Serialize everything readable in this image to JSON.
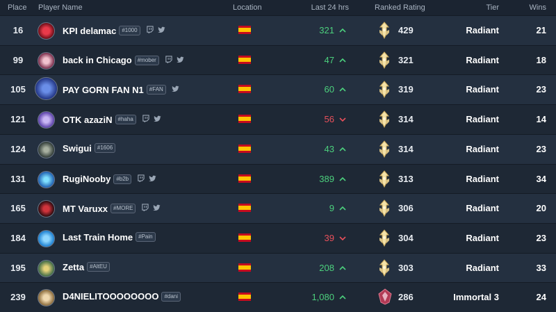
{
  "headers": {
    "place": "Place",
    "player": "Player Name",
    "location": "Location",
    "last24": "Last 24 hrs",
    "rating": "Ranked Rating",
    "tier": "Tier",
    "wins": "Wins"
  },
  "colors": {
    "up": "#4cd07d",
    "down": "#e8505b"
  },
  "rows": [
    {
      "place": "16",
      "name": "KPI delamac",
      "tag": "#1000",
      "social": [
        "twitch-icon",
        "twitter-icon"
      ],
      "location_flag": "spain-flag-icon",
      "last24": "321",
      "trend": "up",
      "rating": "429",
      "tier": "Radiant",
      "wins": "21",
      "rank_icon": "radiant-rank-icon"
    },
    {
      "place": "99",
      "name": "back in Chicago",
      "tag": "#mober",
      "social": [
        "twitch-icon",
        "twitter-icon"
      ],
      "location_flag": "spain-flag-icon",
      "last24": "47",
      "trend": "up",
      "rating": "321",
      "tier": "Radiant",
      "wins": "18",
      "rank_icon": "radiant-rank-icon"
    },
    {
      "place": "105",
      "name": "PAY GORN FAN N1",
      "tag": "#FAN",
      "social": [
        "twitter-icon"
      ],
      "location_flag": "spain-flag-icon",
      "last24": "60",
      "trend": "up",
      "rating": "319",
      "tier": "Radiant",
      "wins": "23",
      "rank_icon": "radiant-rank-icon"
    },
    {
      "place": "121",
      "name": "OTK azaziN",
      "tag": "#haha",
      "social": [
        "twitch-icon",
        "twitter-icon"
      ],
      "location_flag": "spain-flag-icon",
      "last24": "56",
      "trend": "down",
      "rating": "314",
      "tier": "Radiant",
      "wins": "14",
      "rank_icon": "radiant-rank-icon"
    },
    {
      "place": "124",
      "name": "Swigui",
      "tag": "#1606",
      "social": [],
      "location_flag": "spain-flag-icon",
      "last24": "43",
      "trend": "up",
      "rating": "314",
      "tier": "Radiant",
      "wins": "23",
      "rank_icon": "radiant-rank-icon"
    },
    {
      "place": "131",
      "name": "RugiNooby",
      "tag": "#b2b",
      "social": [
        "twitch-icon",
        "twitter-icon"
      ],
      "location_flag": "spain-flag-icon",
      "last24": "389",
      "trend": "up",
      "rating": "313",
      "tier": "Radiant",
      "wins": "34",
      "rank_icon": "radiant-rank-icon"
    },
    {
      "place": "165",
      "name": "MT Varuxx",
      "tag": "#MORE",
      "social": [
        "twitch-icon",
        "twitter-icon"
      ],
      "location_flag": "spain-flag-icon",
      "last24": "9",
      "trend": "up",
      "rating": "306",
      "tier": "Radiant",
      "wins": "20",
      "rank_icon": "radiant-rank-icon"
    },
    {
      "place": "184",
      "name": "Last Train Home",
      "tag": "#Pain",
      "social": [],
      "location_flag": "spain-flag-icon",
      "last24": "39",
      "trend": "down",
      "rating": "304",
      "tier": "Radiant",
      "wins": "23",
      "rank_icon": "radiant-rank-icon"
    },
    {
      "place": "195",
      "name": "Zetta",
      "tag": "#AltEU",
      "social": [],
      "location_flag": "spain-flag-icon",
      "last24": "208",
      "trend": "up",
      "rating": "303",
      "tier": "Radiant",
      "wins": "33",
      "rank_icon": "radiant-rank-icon"
    },
    {
      "place": "239",
      "name": "D4NIELITOOOOOOOO",
      "tag": "#dani",
      "social": [],
      "location_flag": "spain-flag-icon",
      "last24": "1,080",
      "trend": "up",
      "rating": "286",
      "tier": "Immortal 3",
      "wins": "24",
      "rank_icon": "immortal-rank-icon"
    }
  ]
}
